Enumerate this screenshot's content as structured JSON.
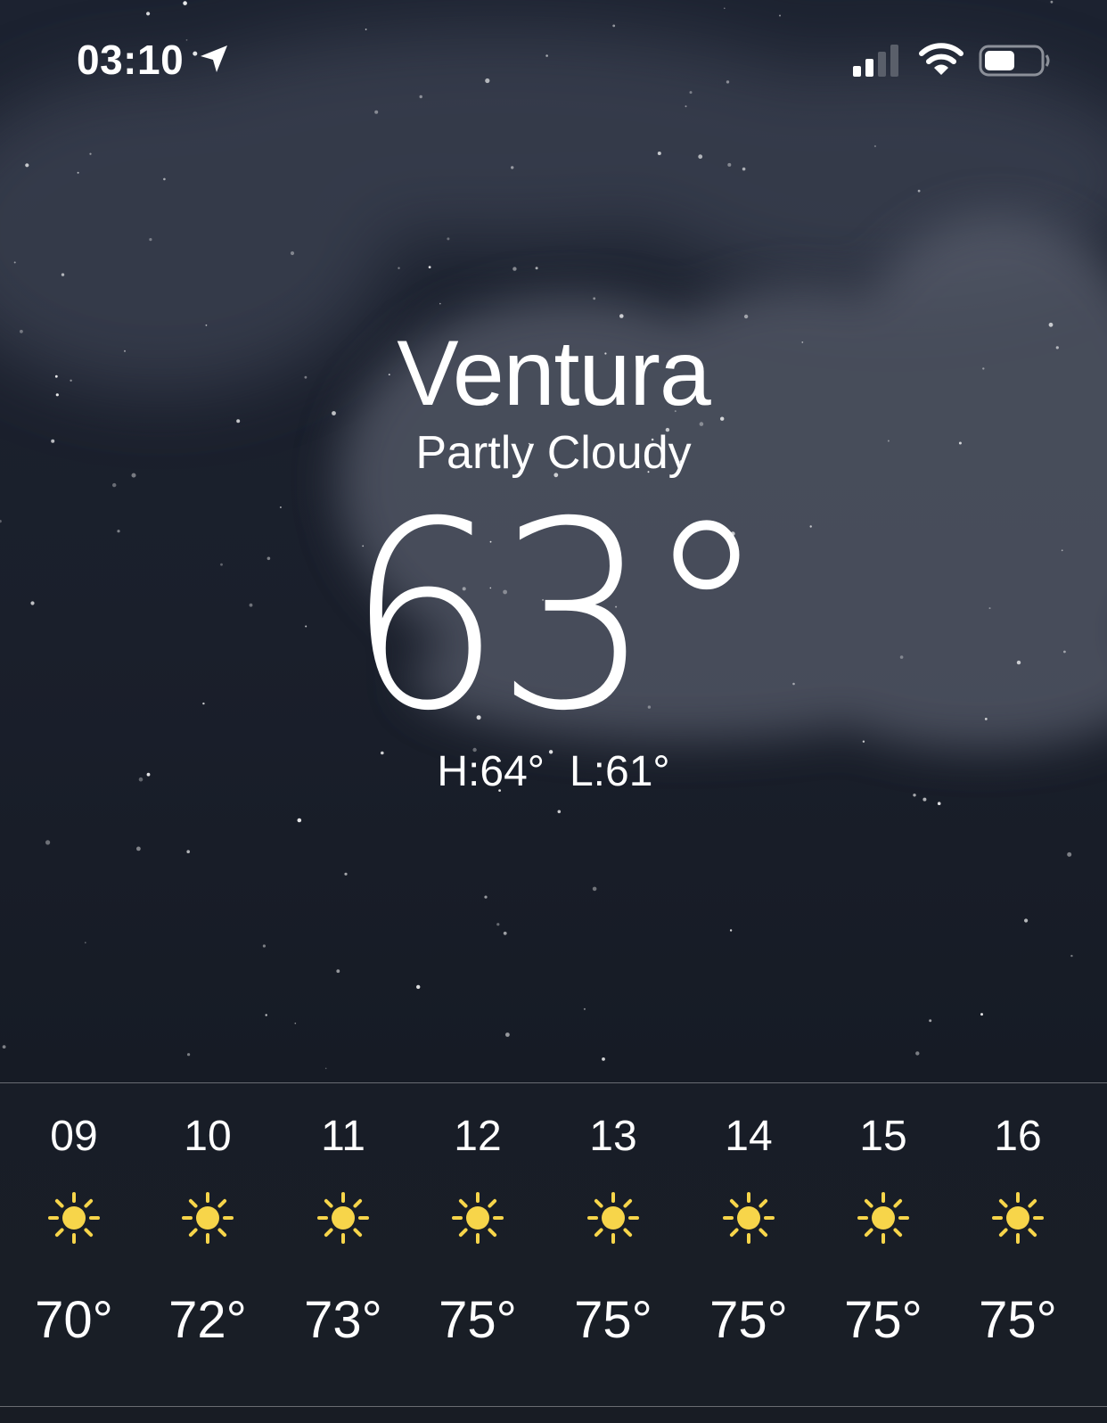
{
  "status_bar": {
    "time": "03:10",
    "location_icon": "location-arrow-icon",
    "signal_icon": "cellular-signal-icon",
    "wifi_icon": "wifi-icon",
    "battery_icon": "battery-icon",
    "battery_level": 0.55
  },
  "current": {
    "city": "Ventura",
    "condition": "Partly Cloudy",
    "temperature": "63°",
    "high": "H:64°",
    "low": "L:61°"
  },
  "hourly": [
    {
      "hour": "09",
      "icon": "sun-icon",
      "temp": "70°"
    },
    {
      "hour": "10",
      "icon": "sun-icon",
      "temp": "72°"
    },
    {
      "hour": "11",
      "icon": "sun-icon",
      "temp": "73°"
    },
    {
      "hour": "12",
      "icon": "sun-icon",
      "temp": "75°"
    },
    {
      "hour": "13",
      "icon": "sun-icon",
      "temp": "75°"
    },
    {
      "hour": "14",
      "icon": "sun-icon",
      "temp": "75°"
    },
    {
      "hour": "15",
      "icon": "sun-icon",
      "temp": "75°"
    },
    {
      "hour": "16",
      "icon": "sun-icon",
      "temp": "75°"
    }
  ],
  "colors": {
    "sun": "#f7d54a",
    "text": "#ffffff",
    "background": "#1a1f2b"
  }
}
